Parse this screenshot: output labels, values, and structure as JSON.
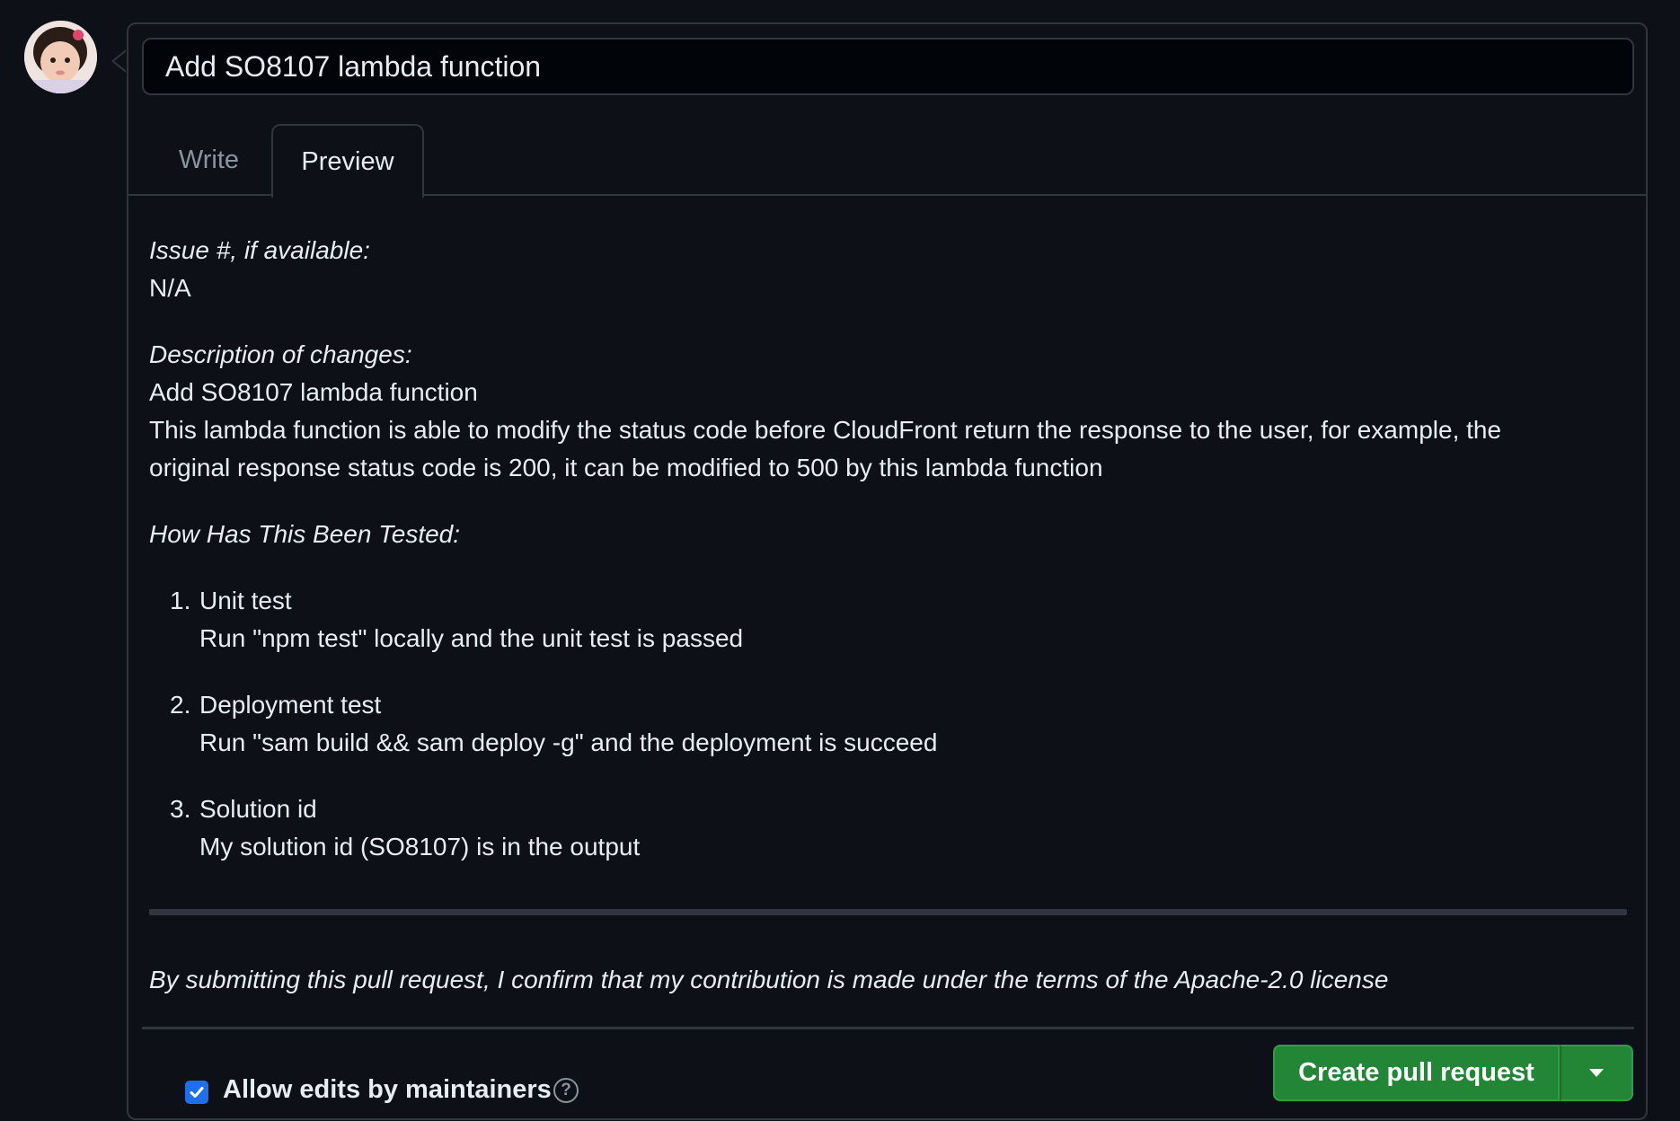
{
  "title_input": {
    "value": "Add SO8107 lambda function"
  },
  "tabs": [
    {
      "label": "Write",
      "active": false
    },
    {
      "label": "Preview",
      "active": true
    }
  ],
  "preview": {
    "issue_heading": "Issue #, if available:",
    "issue_value": "N/A",
    "desc_heading": "Description of changes:",
    "desc_line1": "Add SO8107 lambda function",
    "desc_line2": "This lambda function is able to modify the status code before CloudFront return the response to the user, for example, the",
    "desc_line3": "original response status code is 200, it can be modified to 500 by this lambda function",
    "tested_heading": "How Has This Been Tested:",
    "tests": [
      {
        "num": "1.",
        "title": "Unit test",
        "detail": "Run \"npm test\" locally and the unit test is passed"
      },
      {
        "num": "2.",
        "title": "Deployment test",
        "detail": "Run \"sam build && sam deploy -g\" and the deployment is succeed"
      },
      {
        "num": "3.",
        "title": "Solution id",
        "detail": "My solution id (SO8107) is in the output"
      }
    ],
    "license_note": "By submitting this pull request, I confirm that my contribution is made under the terms of the Apache-2.0 license"
  },
  "footer": {
    "allow_edits_label": "Allow edits by maintainers",
    "allow_edits_checked": true,
    "help_glyph": "?",
    "create_button_label": "Create pull request"
  },
  "colors": {
    "background": "#0d1117",
    "border": "#30363d",
    "primary_button": "#238636",
    "checkbox": "#1f6feb"
  },
  "icons": [
    "avatar",
    "help-icon",
    "check-icon",
    "caret-down-icon"
  ]
}
